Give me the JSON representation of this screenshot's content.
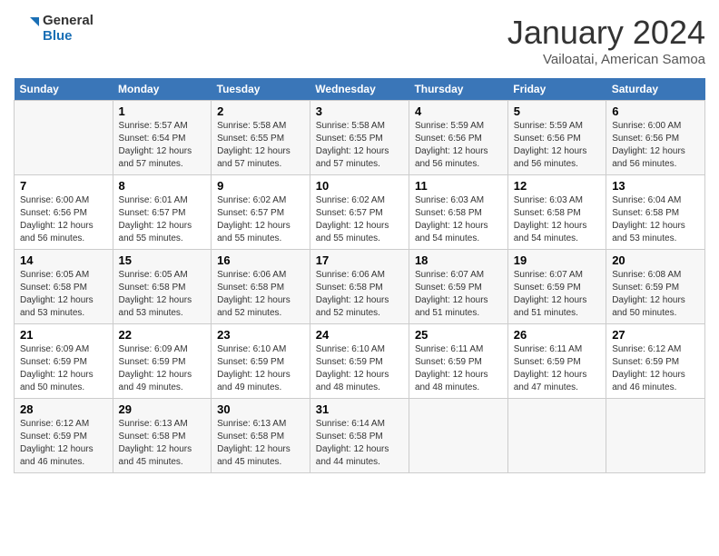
{
  "logo": {
    "line1": "General",
    "line2": "Blue"
  },
  "title": "January 2024",
  "location": "Vailoatai, American Samoa",
  "weekdays": [
    "Sunday",
    "Monday",
    "Tuesday",
    "Wednesday",
    "Thursday",
    "Friday",
    "Saturday"
  ],
  "weeks": [
    [
      {
        "day": "",
        "info": ""
      },
      {
        "day": "1",
        "info": "Sunrise: 5:57 AM\nSunset: 6:54 PM\nDaylight: 12 hours\nand 57 minutes."
      },
      {
        "day": "2",
        "info": "Sunrise: 5:58 AM\nSunset: 6:55 PM\nDaylight: 12 hours\nand 57 minutes."
      },
      {
        "day": "3",
        "info": "Sunrise: 5:58 AM\nSunset: 6:55 PM\nDaylight: 12 hours\nand 57 minutes."
      },
      {
        "day": "4",
        "info": "Sunrise: 5:59 AM\nSunset: 6:56 PM\nDaylight: 12 hours\nand 56 minutes."
      },
      {
        "day": "5",
        "info": "Sunrise: 5:59 AM\nSunset: 6:56 PM\nDaylight: 12 hours\nand 56 minutes."
      },
      {
        "day": "6",
        "info": "Sunrise: 6:00 AM\nSunset: 6:56 PM\nDaylight: 12 hours\nand 56 minutes."
      }
    ],
    [
      {
        "day": "7",
        "info": "Sunrise: 6:00 AM\nSunset: 6:56 PM\nDaylight: 12 hours\nand 56 minutes."
      },
      {
        "day": "8",
        "info": "Sunrise: 6:01 AM\nSunset: 6:57 PM\nDaylight: 12 hours\nand 55 minutes."
      },
      {
        "day": "9",
        "info": "Sunrise: 6:02 AM\nSunset: 6:57 PM\nDaylight: 12 hours\nand 55 minutes."
      },
      {
        "day": "10",
        "info": "Sunrise: 6:02 AM\nSunset: 6:57 PM\nDaylight: 12 hours\nand 55 minutes."
      },
      {
        "day": "11",
        "info": "Sunrise: 6:03 AM\nSunset: 6:58 PM\nDaylight: 12 hours\nand 54 minutes."
      },
      {
        "day": "12",
        "info": "Sunrise: 6:03 AM\nSunset: 6:58 PM\nDaylight: 12 hours\nand 54 minutes."
      },
      {
        "day": "13",
        "info": "Sunrise: 6:04 AM\nSunset: 6:58 PM\nDaylight: 12 hours\nand 53 minutes."
      }
    ],
    [
      {
        "day": "14",
        "info": "Sunrise: 6:05 AM\nSunset: 6:58 PM\nDaylight: 12 hours\nand 53 minutes."
      },
      {
        "day": "15",
        "info": "Sunrise: 6:05 AM\nSunset: 6:58 PM\nDaylight: 12 hours\nand 53 minutes."
      },
      {
        "day": "16",
        "info": "Sunrise: 6:06 AM\nSunset: 6:58 PM\nDaylight: 12 hours\nand 52 minutes."
      },
      {
        "day": "17",
        "info": "Sunrise: 6:06 AM\nSunset: 6:58 PM\nDaylight: 12 hours\nand 52 minutes."
      },
      {
        "day": "18",
        "info": "Sunrise: 6:07 AM\nSunset: 6:59 PM\nDaylight: 12 hours\nand 51 minutes."
      },
      {
        "day": "19",
        "info": "Sunrise: 6:07 AM\nSunset: 6:59 PM\nDaylight: 12 hours\nand 51 minutes."
      },
      {
        "day": "20",
        "info": "Sunrise: 6:08 AM\nSunset: 6:59 PM\nDaylight: 12 hours\nand 50 minutes."
      }
    ],
    [
      {
        "day": "21",
        "info": "Sunrise: 6:09 AM\nSunset: 6:59 PM\nDaylight: 12 hours\nand 50 minutes."
      },
      {
        "day": "22",
        "info": "Sunrise: 6:09 AM\nSunset: 6:59 PM\nDaylight: 12 hours\nand 49 minutes."
      },
      {
        "day": "23",
        "info": "Sunrise: 6:10 AM\nSunset: 6:59 PM\nDaylight: 12 hours\nand 49 minutes."
      },
      {
        "day": "24",
        "info": "Sunrise: 6:10 AM\nSunset: 6:59 PM\nDaylight: 12 hours\nand 48 minutes."
      },
      {
        "day": "25",
        "info": "Sunrise: 6:11 AM\nSunset: 6:59 PM\nDaylight: 12 hours\nand 48 minutes."
      },
      {
        "day": "26",
        "info": "Sunrise: 6:11 AM\nSunset: 6:59 PM\nDaylight: 12 hours\nand 47 minutes."
      },
      {
        "day": "27",
        "info": "Sunrise: 6:12 AM\nSunset: 6:59 PM\nDaylight: 12 hours\nand 46 minutes."
      }
    ],
    [
      {
        "day": "28",
        "info": "Sunrise: 6:12 AM\nSunset: 6:59 PM\nDaylight: 12 hours\nand 46 minutes."
      },
      {
        "day": "29",
        "info": "Sunrise: 6:13 AM\nSunset: 6:58 PM\nDaylight: 12 hours\nand 45 minutes."
      },
      {
        "day": "30",
        "info": "Sunrise: 6:13 AM\nSunset: 6:58 PM\nDaylight: 12 hours\nand 45 minutes."
      },
      {
        "day": "31",
        "info": "Sunrise: 6:14 AM\nSunset: 6:58 PM\nDaylight: 12 hours\nand 44 minutes."
      },
      {
        "day": "",
        "info": ""
      },
      {
        "day": "",
        "info": ""
      },
      {
        "day": "",
        "info": ""
      }
    ]
  ]
}
